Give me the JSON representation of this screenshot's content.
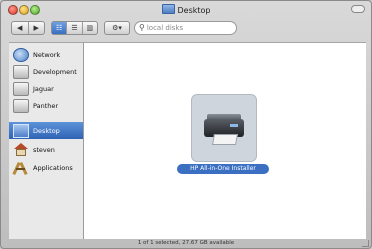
{
  "window": {
    "title": "Desktop"
  },
  "toolbar": {
    "back_glyph": "◀",
    "forward_glyph": "▶",
    "view_glyphs": [
      "☷",
      "☰",
      "▥"
    ],
    "action_glyph": "⚙▾",
    "search_placeholder": "local disks",
    "search_glyph": "⚲"
  },
  "sidebar": {
    "items": [
      {
        "label": "Network",
        "icon": "network-globe-icon"
      },
      {
        "label": "Development",
        "icon": "hard-disk-icon"
      },
      {
        "label": "Jaguar",
        "icon": "hard-disk-icon"
      },
      {
        "label": "Panther",
        "icon": "hard-disk-icon"
      },
      {
        "label": "Desktop",
        "icon": "desktop-icon",
        "selected": true
      },
      {
        "label": "steven",
        "icon": "home-icon"
      },
      {
        "label": "Applications",
        "icon": "applications-icon"
      }
    ]
  },
  "content": {
    "items": [
      {
        "label": "HP All-in-One Installer",
        "icon": "printer-icon",
        "selected": true
      }
    ]
  },
  "status": {
    "text": "1 of 1 selected, 27.67 GB available"
  },
  "colors": {
    "selection_blue": "#3a6fc2",
    "window_gray": "#c9c9c9"
  }
}
